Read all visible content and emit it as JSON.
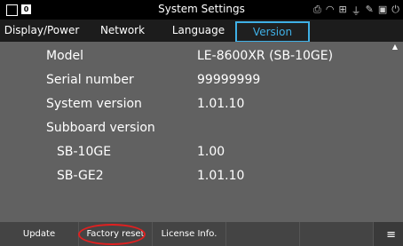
{
  "statusbar": {
    "title": "System Settings",
    "badge": "0"
  },
  "tabs": [
    {
      "label": "Display/Power"
    },
    {
      "label": "Network"
    },
    {
      "label": "Language"
    },
    {
      "label": "Version"
    }
  ],
  "info": {
    "model_label": "Model",
    "model_value": "LE-8600XR (SB-10GE)",
    "serial_label": "Serial number",
    "serial_value": "99999999",
    "sysver_label": "System version",
    "sysver_value": "1.01.10",
    "subboard_label": "Subboard version",
    "sb10_label": "SB-10GE",
    "sb10_value": "1.00",
    "sbge2_label": "SB-GE2",
    "sbge2_value": "1.01.10"
  },
  "bottom": {
    "update": "Update",
    "factory_reset": "Factory reset",
    "license": "License Info."
  },
  "colors": {
    "accent": "#3fb0e6",
    "highlight_ellipse": "#e02020"
  }
}
